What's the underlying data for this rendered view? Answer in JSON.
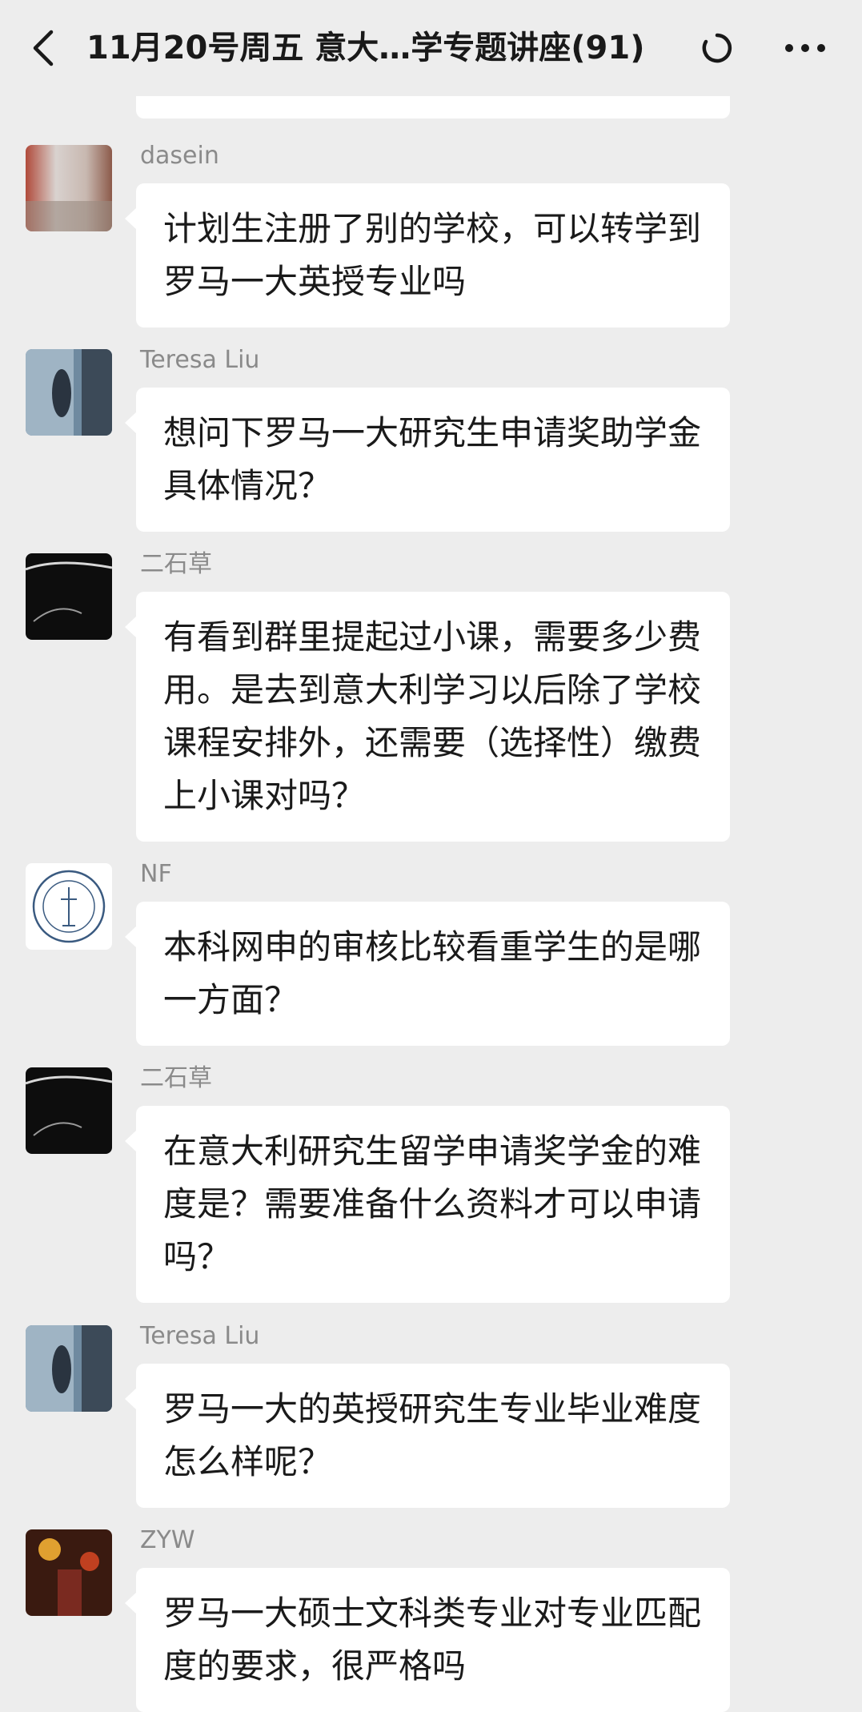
{
  "header": {
    "title": "11月20号周五 意大…学专题讲座(91)",
    "back_icon": "chevron-left-icon",
    "status_icon": "loading-icon",
    "more_icon": "more-horizontal-icon"
  },
  "messages": [
    {
      "sender": "dasein",
      "text": "计划生注册了别的学校，可以转学到罗马一大英授专业吗"
    },
    {
      "sender": "Teresa Liu",
      "text": "想问下罗马一大研究生申请奖助学金具体情况？"
    },
    {
      "sender": "二石草",
      "text": "有看到群里提起过小课，需要多少费用。是去到意大利学习以后除了学校课程安排外，还需要（选择性）缴费上小课对吗？"
    },
    {
      "sender": "NF",
      "text": "本科网申的审核比较看重学生的是哪一方面？"
    },
    {
      "sender": "二石草",
      "text": "在意大利研究生留学申请奖学金的难度是？需要准备什么资料才可以申请吗？"
    },
    {
      "sender": "Teresa Liu",
      "text": "罗马一大的英授研究生专业毕业难度怎么样呢？"
    },
    {
      "sender": "ZYW",
      "text": "罗马一大硕士文科类专业对专业匹配度的要求，很严格吗"
    }
  ],
  "colors": {
    "background": "#ededed",
    "bubble": "#ffffff",
    "sender_name": "#8a8a8a",
    "text": "#1a1a1a"
  }
}
